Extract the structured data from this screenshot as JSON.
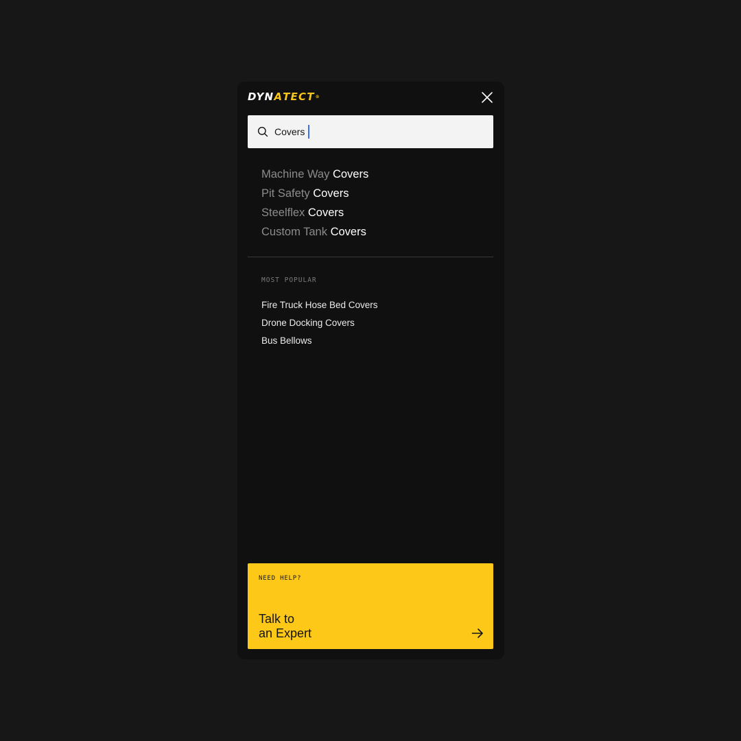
{
  "brand": {
    "logo_part1": "DYN",
    "logo_part2": "A",
    "logo_part3": "TECT",
    "logo_mark": "®",
    "accent_color": "#f7c51c"
  },
  "header": {
    "close_icon": "close-icon"
  },
  "search": {
    "icon": "search-icon",
    "value": "Covers"
  },
  "suggestions": [
    {
      "prefix": "Machine Way ",
      "match": "Covers"
    },
    {
      "prefix": "Pit Safety ",
      "match": "Covers"
    },
    {
      "prefix": "Steelflex ",
      "match": "Covers"
    },
    {
      "prefix": "Custom Tank ",
      "match": "Covers"
    }
  ],
  "popular": {
    "title": "MOST POPULAR",
    "items": [
      "Fire Truck Hose Bed Covers",
      "Drone Docking Covers",
      "Bus Bellows"
    ]
  },
  "help": {
    "kicker": "NEED HELP?",
    "title_line1": "Talk to",
    "title_line2": "an Expert",
    "arrow_icon": "arrow-right-icon",
    "background": "#fdc817"
  }
}
